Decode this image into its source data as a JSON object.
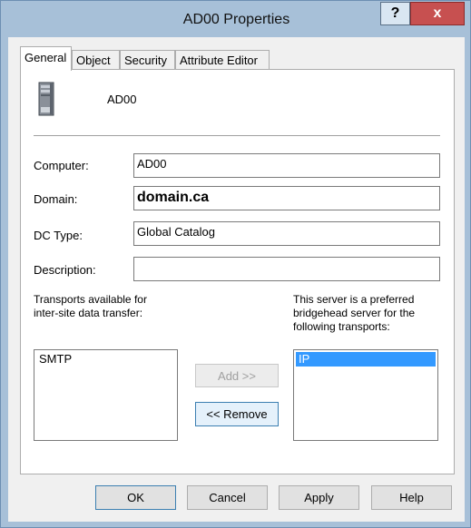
{
  "window": {
    "title": "AD00 Properties",
    "help_label": "?",
    "close_label": "x"
  },
  "tabs": [
    {
      "label": "General",
      "active": true
    },
    {
      "label": "Object",
      "active": false
    },
    {
      "label": "Security",
      "active": false
    },
    {
      "label": "Attribute Editor",
      "active": false
    }
  ],
  "general": {
    "server_name": "AD00",
    "icon": "server-icon",
    "fields": {
      "computer_label": "Computer:",
      "computer_value": "AD00",
      "domain_label": "Domain:",
      "domain_value": "domain.ca",
      "dc_type_label": "DC Type:",
      "dc_type_value": "Global Catalog",
      "description_label": "Description:",
      "description_value": ""
    },
    "transports": {
      "available_caption_line1": "Transports available for",
      "available_caption_line2": "inter-site data transfer:",
      "available_items": [
        "SMTP"
      ],
      "preferred_caption_line1": "This server is a preferred",
      "preferred_caption_line2": "bridgehead server for the",
      "preferred_caption_line3": "following transports:",
      "preferred_items": [
        "IP"
      ],
      "add_label": "Add >>",
      "remove_label": "<< Remove"
    }
  },
  "footer": {
    "ok_label": "OK",
    "cancel_label": "Cancel",
    "apply_label": "Apply",
    "help_label": "Help"
  },
  "colors": {
    "selection": "#3399ff",
    "close_button": "#c75050",
    "frame": "#a7c0d8"
  }
}
